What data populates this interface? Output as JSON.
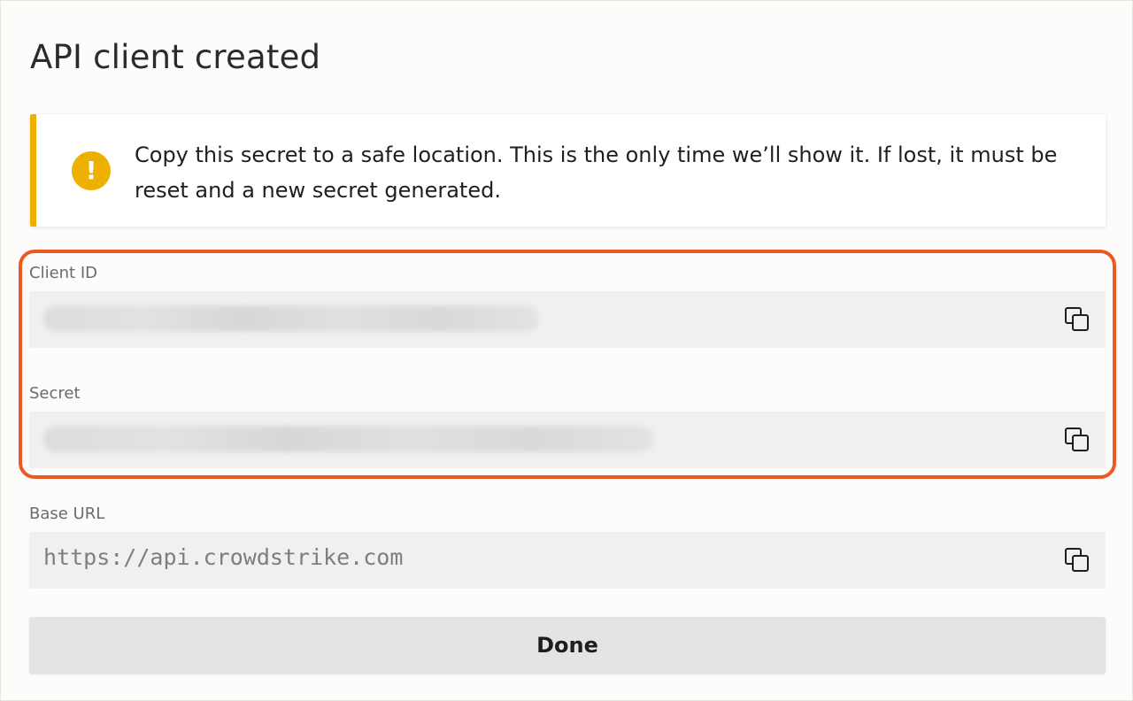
{
  "dialog": {
    "title": "API client created"
  },
  "alert": {
    "icon": "exclamation-icon",
    "text": "Copy this secret to a safe location. This is the only time we’ll show it. If lost, it must be reset and a new secret generated.",
    "accent_color": "#ecb001"
  },
  "highlight": {
    "color": "#ec5a24"
  },
  "fields": {
    "client_id": {
      "label": "Client ID",
      "value_blurred": true
    },
    "secret": {
      "label": "Secret",
      "value_blurred": true
    },
    "base_url": {
      "label": "Base URL",
      "value": "https://api.crowdstrike.com"
    }
  },
  "copy_icon": "copy-icon",
  "done_button": {
    "label": "Done"
  }
}
